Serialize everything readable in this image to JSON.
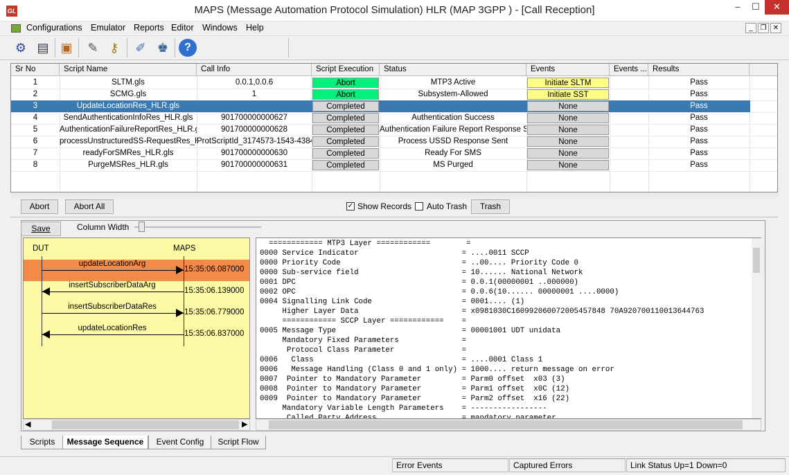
{
  "window": {
    "title": "MAPS (Message Automation Protocol Simulation) HLR (MAP 3GPP ) - [Call Reception]",
    "logo": "GL",
    "controls": {
      "minimize": "–",
      "maximize": "☐",
      "close": "✕"
    }
  },
  "menu": [
    "Configurations",
    "Emulator",
    "Reports",
    "Editor",
    "Windows",
    "Help"
  ],
  "mdi_controls": {
    "minimize": "_",
    "restore": "❐",
    "close": "✕"
  },
  "toolbar": [
    {
      "icon": "gear-icon",
      "glyph": "⚙"
    },
    {
      "icon": "notebook-icon",
      "glyph": "▤"
    },
    {
      "icon": "briefcase-icon",
      "glyph": "▣"
    },
    {
      "icon": "script-edit-icon",
      "glyph": "✎"
    },
    {
      "icon": "keys-icon",
      "glyph": "⚷"
    },
    {
      "icon": "pen-check-icon",
      "glyph": "✐"
    },
    {
      "icon": "person-icon",
      "glyph": "♚"
    },
    {
      "icon": "help-icon",
      "glyph": "?"
    }
  ],
  "grid": {
    "columns": [
      "Sr No",
      "Script Name",
      "Call Info",
      "Script Execution",
      "Status",
      "Events",
      "Events ...",
      "Results"
    ],
    "rows": [
      {
        "sr": "1",
        "script": "SLTM.gls",
        "call": "0.0.1,0.0.6",
        "exec": "Abort",
        "status": "MTP3 Active",
        "events": "Initiate SLTM",
        "result": "Pass"
      },
      {
        "sr": "2",
        "script": "SCMG.gls",
        "call": "1",
        "exec": "Abort",
        "status": "Subsystem-Allowed",
        "events": "Initiate SST",
        "result": "Pass"
      },
      {
        "sr": "3",
        "script": "UpdateLocationRes_HLR.gls",
        "call": "",
        "exec": "Completed",
        "status": "",
        "events": "None",
        "result": "Pass"
      },
      {
        "sr": "4",
        "script": "SendAuthenticationInfoRes_HLR.gls",
        "call": "901700000000627",
        "exec": "Completed",
        "status": "Authentication Success",
        "events": "None",
        "result": "Pass"
      },
      {
        "sr": "5",
        "script": "AuthenticationFailureReportRes_HLR.gls",
        "call": "901700000000628",
        "exec": "Completed",
        "status": "Authentication Failure Report Response S...",
        "events": "None",
        "result": "Pass"
      },
      {
        "sr": "6",
        "script": "processUnstructuredSS-RequestRes_H...",
        "call": "ProtScriptId_3174573-1543-4384",
        "exec": "Completed",
        "status": "Process USSD Response Sent",
        "events": "None",
        "result": "Pass"
      },
      {
        "sr": "7",
        "script": "readyForSMRes_HLR.gls",
        "call": "901700000000630",
        "exec": "Completed",
        "status": "Ready For SMS",
        "events": "None",
        "result": "Pass"
      },
      {
        "sr": "8",
        "script": "PurgeMSRes_HLR.gls",
        "call": "901700000000631",
        "exec": "Completed",
        "status": "MS Purged",
        "events": "None",
        "result": "Pass"
      }
    ]
  },
  "controls": {
    "abort": "Abort",
    "abort_all": "Abort All",
    "show_records": "Show Records",
    "show_records_checked": true,
    "auto_trash": "Auto Trash",
    "auto_trash_checked": false,
    "trash": "Trash",
    "save": "Save",
    "column_width": "Column Width"
  },
  "sequence": {
    "left_entity": "DUT",
    "right_entity": "MAPS",
    "messages": [
      {
        "label": "updateLocationArg",
        "time": "15:35:06.087000",
        "direction": "right"
      },
      {
        "label": "insertSubscriberDataArg",
        "time": "15:35:06.139000",
        "direction": "left"
      },
      {
        "label": "insertSubscriberDataRes",
        "time": "15:35:06.779000",
        "direction": "right"
      },
      {
        "label": "updateLocationRes",
        "time": "15:35:06.837000",
        "direction": "left"
      }
    ]
  },
  "decode": [
    "  ============ MTP3 Layer ============        =",
    "0000 Service Indicator                       = ....0011 SCCP",
    "0000 Priority Code                           = ..00.... Priority Code 0",
    "0000 Sub-service field                       = 10...... National Network",
    "0001 DPC                                     = 0.0.1(00000001 ..000000)",
    "0002 OPC                                     = 0.0.6(10...... 00000001 ....0000)",
    "0004 Signalling Link Code                    = 0001.... (1)",
    "     Higher Layer Data                       = x0981030C160992060072005457848 70A920700110013644763",
    "     ============ SCCP Layer ============    =",
    "0005 Message Type                            = 00001001 UDT unidata",
    "     Mandatory Fixed Parameters              =",
    "      Protocol Class Parameter               =",
    "0006   Class                                 = ....0001 Class 1",
    "0006   Message Handling (Class 0 and 1 only) = 1000.... return message on error",
    "0007  Pointer to Mandatory Parameter         = Parm0 offset  x03 (3)",
    "0008  Pointer to Mandatory Parameter         = Parm1 offset  x0C (12)",
    "0009  Pointer to Mandatory Parameter         = Parm2 offset  x16 (22)",
    "     Mandatory Variable Length Parameters    = -----------------",
    "      Called Party Address                   = mandatory parameter"
  ],
  "tabs": [
    "Scripts",
    "Message Sequence",
    "Event Config",
    "Script Flow"
  ],
  "active_tab": "Message Sequence",
  "status_bar": [
    "Error Events",
    "Captured Errors",
    "Link Status Up=1 Down=0"
  ],
  "colors": {
    "abort_green": "#00f07a",
    "events_yellow": "#ffff80",
    "selected_row": "#3a7ab0",
    "sequence_bg": "#fdfaa5",
    "sequence_highlight": "#f48a48"
  }
}
